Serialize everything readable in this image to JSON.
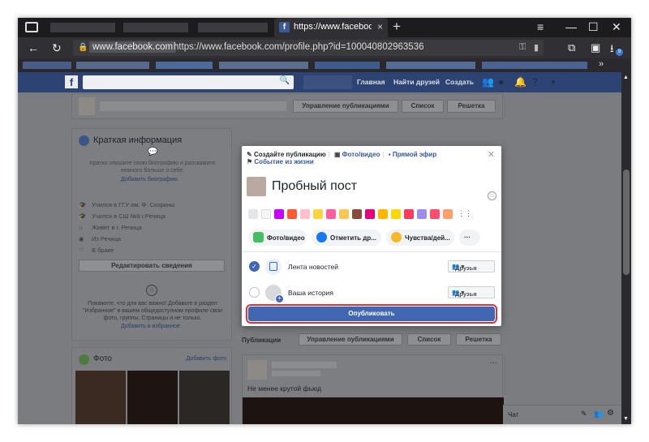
{
  "browser": {
    "tab_title": "https://www.facebook.cc",
    "tab_close": "×",
    "new_tab": "+",
    "url_host": "www.facebook.com",
    "url_full": "https://www.facebook.com/profile.php?id=100040802963536",
    "download_badge": "9",
    "bookmarks_more": "»"
  },
  "fbnav": {
    "logo": "f",
    "home": "Главная",
    "find_friends": "Найти друзей",
    "create": "Создать"
  },
  "cover_bar": {
    "manage_posts": "Управление публикациями",
    "list": "Список",
    "grid": "Решетка"
  },
  "intro": {
    "title": "Краткая информация",
    "bio_prompt": "Кратко опишите свою биографию и расскажите немного больше о себе.",
    "add_bio": "Добавить биографию",
    "items": [
      "Учился в ГГУ им. Ф. Скорины",
      "Учился в СШ №8 г.Речица",
      "Живет в г. Речица",
      "Из Речица",
      "В браке"
    ],
    "edit_button": "Редактировать сведения",
    "featured_text": "Покажите, что для вас важно! Добавьте в раздел \"Избранное\" в вашем общедоступном профиле свои фото, группы, Страницы и не только.",
    "add_featured": "Добавить в избранное"
  },
  "photos": {
    "title": "Фото",
    "add": "Добавить фото"
  },
  "feed": {
    "publications": "Публикации",
    "manage_posts": "Управление публикациями",
    "list": "Список",
    "grid": "Решетка",
    "post_text": "Не менее крутой фьюд",
    "more": "···"
  },
  "chat": {
    "label": "Чат"
  },
  "composer": {
    "create_post": "Создайте публикацию",
    "photo_video": "Фото/видео",
    "live": "Прямой эфир",
    "life_event": "Событие из жизни",
    "post_text": "Пробный пост",
    "chip_photo": "Фото/видео",
    "chip_tag": "Отметить др...",
    "chip_feeling": "Чувства/дей...",
    "chip_more": "···",
    "news_feed": "Лента новостей",
    "story": "Ваша история",
    "audience_feed": "Друзья",
    "audience_story": "Друзья",
    "publish": "Опубликовать",
    "close": "✕"
  },
  "colors": {
    "fb_blue": "#4267b2",
    "fb_nav": "#2d4373",
    "highlight": "#e0303a"
  }
}
